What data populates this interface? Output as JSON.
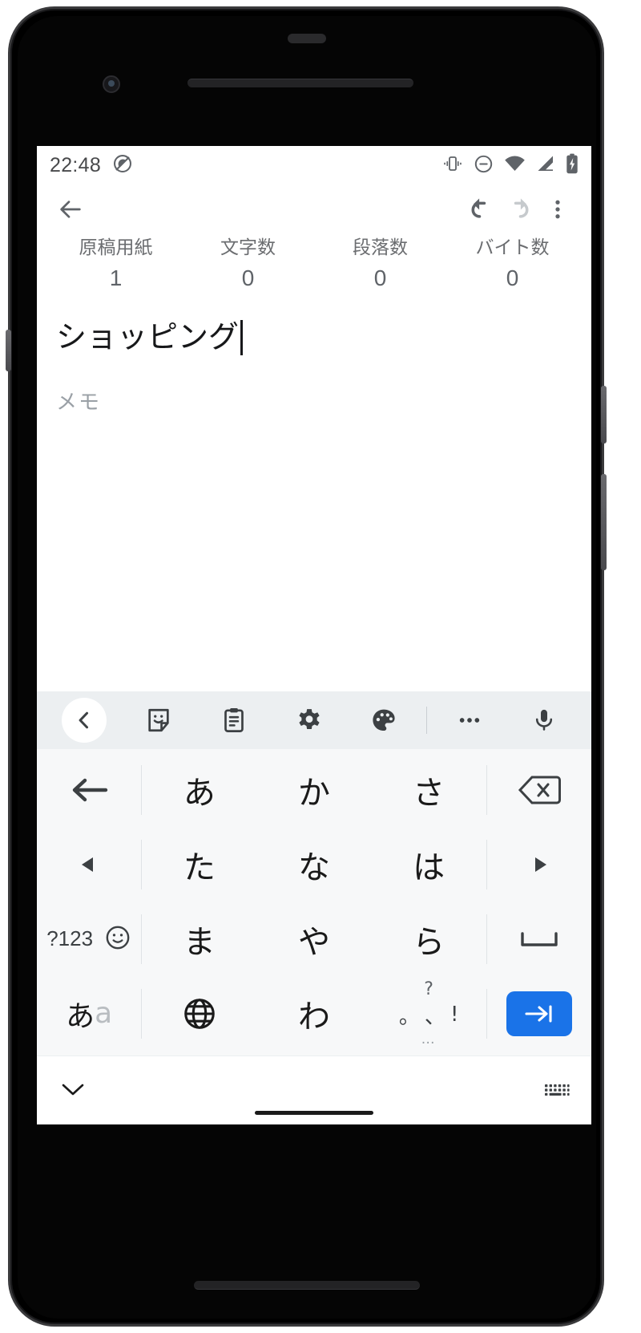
{
  "status_bar": {
    "time": "22:48",
    "left_icons": [
      {
        "name": "do-not-disturb-slash-icon"
      }
    ],
    "right_icons": [
      {
        "name": "vibrate-icon"
      },
      {
        "name": "dnd-icon"
      },
      {
        "name": "wifi-icon"
      },
      {
        "name": "signal-icon"
      },
      {
        "name": "battery-charging-icon"
      }
    ]
  },
  "app_bar": {
    "back_label": "戻る",
    "undo_label": "元に戻す",
    "redo_label": "やり直す",
    "overflow_label": "その他のオプション"
  },
  "stats": [
    {
      "label": "原稿用紙",
      "value": "1"
    },
    {
      "label": "文字数",
      "value": "0"
    },
    {
      "label": "段落数",
      "value": "0"
    },
    {
      "label": "バイト数",
      "value": "0"
    }
  ],
  "editor": {
    "title_value": "ショッピング",
    "body_placeholder": "メモ"
  },
  "keyboard": {
    "toolbar": [
      {
        "name": "expand-back-icon",
        "label": "戻る"
      },
      {
        "name": "sticker-icon",
        "label": "ステッカー"
      },
      {
        "name": "clipboard-icon",
        "label": "クリップボード"
      },
      {
        "name": "settings-gear-icon",
        "label": "設定"
      },
      {
        "name": "palette-icon",
        "label": "テーマ"
      },
      {
        "name": "more-horizontal-icon",
        "label": "その他"
      },
      {
        "name": "microphone-icon",
        "label": "音声入力"
      }
    ],
    "rows": [
      [
        {
          "name": "backspace-left-arrow-key",
          "label": "←",
          "type": "fn"
        },
        {
          "name": "key-a",
          "label": "あ",
          "type": "char"
        },
        {
          "name": "key-ka",
          "label": "か",
          "type": "char"
        },
        {
          "name": "key-sa",
          "label": "さ",
          "type": "char"
        },
        {
          "name": "delete-key",
          "label": "⌫",
          "type": "fn"
        }
      ],
      [
        {
          "name": "cursor-left-key",
          "label": "◀",
          "type": "fn"
        },
        {
          "name": "key-ta",
          "label": "た",
          "type": "char"
        },
        {
          "name": "key-na",
          "label": "な",
          "type": "char"
        },
        {
          "name": "key-ha",
          "label": "は",
          "type": "char"
        },
        {
          "name": "cursor-right-key",
          "label": "▶",
          "type": "fn"
        }
      ],
      [
        {
          "name": "symbols-key",
          "label": "?123",
          "type": "fn"
        },
        {
          "name": "key-ma",
          "label": "ま",
          "type": "char"
        },
        {
          "name": "key-ya",
          "label": "や",
          "type": "char"
        },
        {
          "name": "key-ra",
          "label": "ら",
          "type": "char"
        },
        {
          "name": "space-key",
          "label": "␣",
          "type": "fn"
        }
      ],
      [
        {
          "name": "kana-alpha-toggle-key",
          "label": "あa",
          "type": "fn"
        },
        {
          "name": "language-globe-key",
          "label": "🌐",
          "type": "fn"
        },
        {
          "name": "key-wa",
          "label": "わ",
          "type": "char"
        },
        {
          "name": "punctuation-key",
          "label": "。、？！",
          "type": "punct"
        },
        {
          "name": "enter-key",
          "label": "→|",
          "type": "enter"
        }
      ]
    ],
    "emoji_key_label": "☺",
    "punct_top": "?",
    "punct_mid_1": "。",
    "punct_mid_2": "、",
    "punct_mid_3": "!",
    "punct_bot": "…"
  },
  "nav_bar": {
    "collapse_label": "キーボードを閉じる",
    "switch_ime_label": "入力方法の切り替え"
  },
  "colors": {
    "accent_blue": "#1a73e8",
    "icon_gray": "#5f6368",
    "keyboard_bg": "#f7f8f9",
    "toolbar_bg": "#eceff1"
  }
}
